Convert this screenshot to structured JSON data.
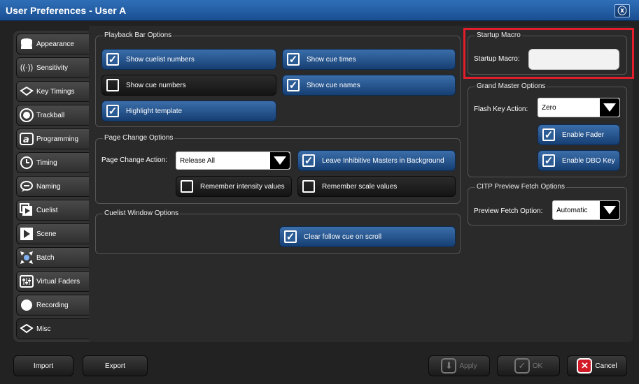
{
  "window": {
    "title": "User Preferences - User A",
    "close_label": "ⓧ"
  },
  "sidebar": {
    "items": [
      {
        "label": "Appearance",
        "icon": "stack-icon"
      },
      {
        "label": "Sensitivity",
        "icon": "signal-icon"
      },
      {
        "label": "Key Timings",
        "icon": "keypad-icon"
      },
      {
        "label": "Trackball",
        "icon": "trackball-icon"
      },
      {
        "label": "Programming",
        "icon": "programming-icon"
      },
      {
        "label": "Timing",
        "icon": "clock-icon"
      },
      {
        "label": "Naming",
        "icon": "speech-bubble-icon"
      },
      {
        "label": "Cuelist",
        "icon": "cuelist-icon"
      },
      {
        "label": "Scene",
        "icon": "scene-icon"
      },
      {
        "label": "Batch",
        "icon": "batch-icon"
      },
      {
        "label": "Virtual Faders",
        "icon": "faders-icon"
      },
      {
        "label": "Recording",
        "icon": "record-icon"
      },
      {
        "label": "Misc",
        "icon": "keypad-icon"
      }
    ],
    "active": "Misc"
  },
  "playback_bar": {
    "title": "Playback Bar Options",
    "show_cuelist_numbers": {
      "label": "Show cuelist numbers",
      "checked": true
    },
    "show_cue_times": {
      "label": "Show cue times",
      "checked": true
    },
    "show_cue_numbers": {
      "label": "Show cue numbers",
      "checked": false
    },
    "show_cue_names": {
      "label": "Show cue names",
      "checked": true
    },
    "highlight_template": {
      "label": "Highlight template",
      "checked": true
    }
  },
  "page_change": {
    "title": "Page Change Options",
    "action_label": "Page Change Action:",
    "action_value": "Release All",
    "leave_inhibitive": {
      "label": "Leave Inhibitive Masters in Background",
      "checked": true
    },
    "remember_intensity": {
      "label": "Remember intensity values",
      "checked": false
    },
    "remember_scale": {
      "label": "Remember scale values",
      "checked": false
    }
  },
  "cuelist_window": {
    "title": "Cuelist Window Options",
    "clear_follow": {
      "label": "Clear follow cue on scroll",
      "checked": true
    }
  },
  "startup_macro": {
    "title": "Startup Macro",
    "label": "Startup Macro:",
    "value": ""
  },
  "grand_master": {
    "title": "Grand Master Options",
    "flash_label": "Flash Key Action:",
    "flash_value": "Zero",
    "enable_fader": {
      "label": "Enable Fader",
      "checked": true
    },
    "enable_dbo": {
      "label": "Enable DBO Key",
      "checked": true
    }
  },
  "citp": {
    "title": "CITP Preview Fetch Options",
    "label": "Preview Fetch Option:",
    "value": "Automatic"
  },
  "footer": {
    "import": "Import",
    "export": "Export",
    "apply": "Apply",
    "ok": "OK",
    "cancel": "Cancel"
  },
  "colors": {
    "accent": "#2b5c95",
    "highlight": "#e21d2c",
    "titlebar": "#1a4f92"
  }
}
